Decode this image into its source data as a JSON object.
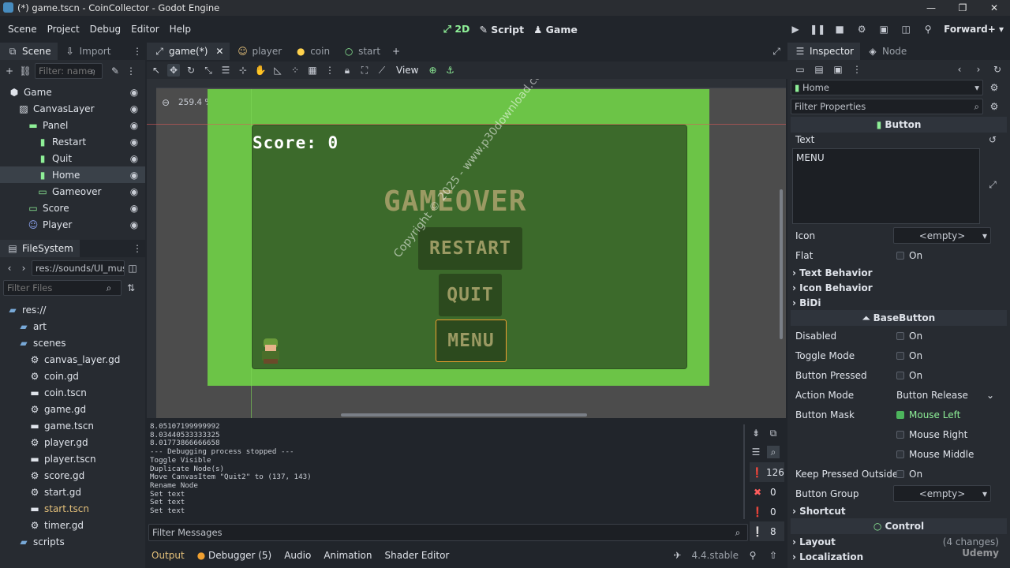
{
  "window": {
    "title": "(*) game.tscn - CoinCollector - Godot Engine",
    "controls": [
      "—",
      "❐",
      "✕"
    ]
  },
  "menu": [
    "Scene",
    "Project",
    "Debug",
    "Editor",
    "Help"
  ],
  "workspaces": [
    "2D",
    "Script",
    "Game"
  ],
  "renderer": "Forward+",
  "scene_dock": {
    "tabs": [
      "Scene",
      "Import"
    ],
    "filter_placeholder": "Filter: name,",
    "tree": [
      {
        "label": "Game",
        "indent": 0,
        "icon": "node-icon"
      },
      {
        "label": "CanvasLayer",
        "indent": 1,
        "icon": "canvas-layer-icon"
      },
      {
        "label": "Panel",
        "indent": 2,
        "icon": "panel-icon"
      },
      {
        "label": "Restart",
        "indent": 3,
        "icon": "button-icon"
      },
      {
        "label": "Quit",
        "indent": 3,
        "icon": "button-icon"
      },
      {
        "label": "Home",
        "indent": 3,
        "icon": "button-icon",
        "selected": true
      },
      {
        "label": "Gameover",
        "indent": 3,
        "icon": "label-icon"
      },
      {
        "label": "Score",
        "indent": 2,
        "icon": "label-icon"
      },
      {
        "label": "Player",
        "indent": 2,
        "icon": "character-icon"
      }
    ]
  },
  "filesystem": {
    "title": "FileSystem",
    "path": "res://sounds/UI_music",
    "filter_placeholder": "Filter Files",
    "items": [
      {
        "label": "res://",
        "indent": 0,
        "type": "folder"
      },
      {
        "label": "art",
        "indent": 1,
        "type": "folder"
      },
      {
        "label": "scenes",
        "indent": 1,
        "type": "folder"
      },
      {
        "label": "canvas_layer.gd",
        "indent": 2,
        "type": "script"
      },
      {
        "label": "coin.gd",
        "indent": 2,
        "type": "script"
      },
      {
        "label": "coin.tscn",
        "indent": 2,
        "type": "scene"
      },
      {
        "label": "game.gd",
        "indent": 2,
        "type": "script"
      },
      {
        "label": "game.tscn",
        "indent": 2,
        "type": "scene"
      },
      {
        "label": "player.gd",
        "indent": 2,
        "type": "script"
      },
      {
        "label": "player.tscn",
        "indent": 2,
        "type": "scene"
      },
      {
        "label": "score.gd",
        "indent": 2,
        "type": "script"
      },
      {
        "label": "start.gd",
        "indent": 2,
        "type": "script"
      },
      {
        "label": "start.tscn",
        "indent": 2,
        "type": "scene",
        "highlight": true
      },
      {
        "label": "timer.gd",
        "indent": 2,
        "type": "script"
      },
      {
        "label": "scripts",
        "indent": 1,
        "type": "folder"
      }
    ]
  },
  "editor_tabs": [
    {
      "label": "game(*)",
      "active": true
    },
    {
      "label": "player"
    },
    {
      "label": "coin"
    },
    {
      "label": "start"
    }
  ],
  "toolbar": {
    "view_label": "View"
  },
  "zoom_label": "259.4 %",
  "game": {
    "score": "Score: 0",
    "gameover": "GAMEOVER",
    "restart": "RESTART",
    "quit": "QUIT",
    "menu": "MENU",
    "watermark": "Copyright © 2025 - www.p30download.com"
  },
  "output": {
    "lines": [
      "8.05107199999992",
      "8.03440533333325",
      "8.01773866666658",
      "--- Debugging process stopped ---",
      "Toggle Visible",
      "Duplicate Node(s)",
      "Move CanvasItem \"Quit2\" to (137, 143)",
      "Rename Node",
      "Set text",
      "Set text",
      "Set text"
    ],
    "filter_placeholder": "Filter Messages",
    "counts": {
      "messages": "126",
      "errors": "0",
      "warnings": "0",
      "editor": "8"
    },
    "bottom_tabs": [
      "Output",
      "Debugger (5)",
      "Audio",
      "Animation",
      "Shader Editor"
    ],
    "version": "4.4.stable"
  },
  "inspector": {
    "tabs": [
      "Inspector",
      "Node"
    ],
    "object": "Home",
    "filter_placeholder": "Filter Properties",
    "button_section": "Button",
    "text_label": "Text",
    "text_value": "MENU",
    "icon_label": "Icon",
    "icon_value": "<empty>",
    "flat_label": "Flat",
    "on": "On",
    "text_behavior": "Text Behavior",
    "icon_behavior": "Icon Behavior",
    "bidi": "BiDi",
    "basebutton_section": "BaseButton",
    "disabled": "Disabled",
    "toggle_mode": "Toggle Mode",
    "button_pressed": "Button Pressed",
    "action_mode": "Action Mode",
    "action_mode_value": "Button Release",
    "button_mask": "Button Mask",
    "mouse_left": "Mouse Left",
    "mouse_right": "Mouse Right",
    "mouse_middle": "Mouse Middle",
    "keep_pressed": "Keep Pressed Outside",
    "button_group": "Button Group",
    "button_group_value": "<empty>",
    "shortcut": "Shortcut",
    "control_section": "Control",
    "layout": "Layout",
    "layout_changes": "(4 changes)",
    "localization": "Localization"
  },
  "colors": {
    "accent": "#8eef97",
    "selected": "#3a4149",
    "grass": "#6cc447"
  },
  "udemy": "Udemy"
}
